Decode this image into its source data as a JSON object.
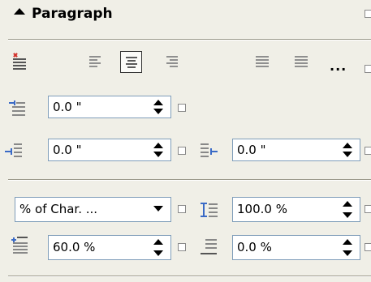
{
  "panel": {
    "title": "Paragraph",
    "more_label": "...",
    "collapse_icon": "triangle-up-icon"
  },
  "alignment": {
    "buttons": [
      {
        "name": "left",
        "icon": "align-left-icon",
        "active": false
      },
      {
        "name": "center",
        "icon": "align-center-icon",
        "active": true
      },
      {
        "name": "right",
        "icon": "align-right-icon",
        "active": false
      },
      {
        "name": "justify",
        "icon": "align-justify-icon",
        "active": false
      },
      {
        "name": "full-justify",
        "icon": "align-full-justify-icon",
        "active": false
      }
    ]
  },
  "indent": {
    "first_line": "0.0 \"",
    "left": "0.0 \"",
    "right": "0.0 \""
  },
  "spacing": {
    "line_spacing_unit": "% of Char. ...",
    "line_spacing": "100.0 %",
    "before_paragraph": "60.0 %",
    "after_paragraph": "0.0 %"
  },
  "colors": {
    "panel_bg": "#f0efe7",
    "field_border": "#7f9db9",
    "accent_blue": "#3a6ac6",
    "accent_red": "#d2302a"
  }
}
